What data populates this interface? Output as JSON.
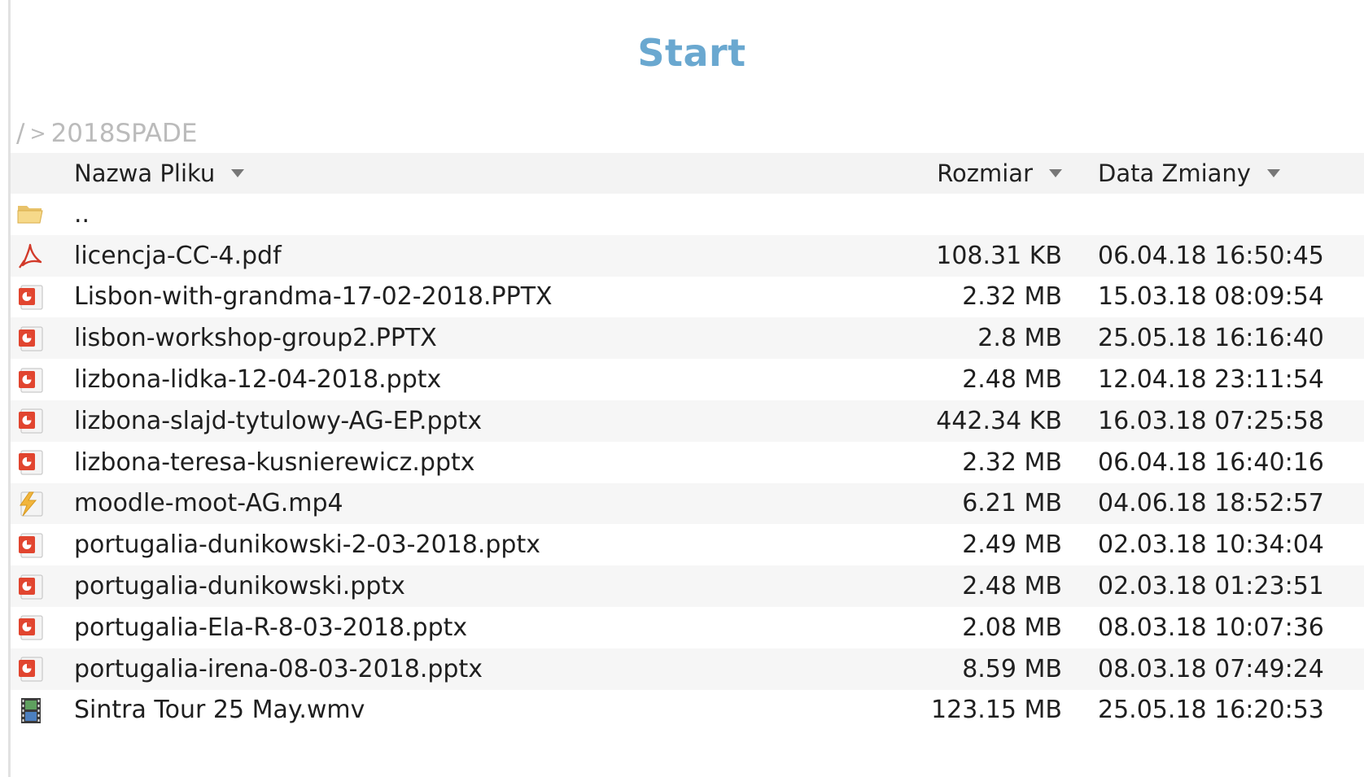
{
  "page": {
    "title": "Start"
  },
  "breadcrumb": {
    "root": "/",
    "separator": ">",
    "current": "2018SPADE"
  },
  "columns": {
    "name": "Nazwa Pliku",
    "size": "Rozmiar",
    "date": "Data Zmiany"
  },
  "colors": {
    "title": "#6aa8d0",
    "breadcrumb": "#bbbbbb",
    "stripe": "#f6f6f6"
  },
  "parent": {
    "label": "..",
    "icon": "folder-open-icon"
  },
  "files": [
    {
      "name": "licencja-CC-4.pdf",
      "size": "108.31 KB",
      "date": "06.04.18 16:50:45",
      "icon": "pdf-icon"
    },
    {
      "name": "Lisbon-with-grandma-17-02-2018.PPTX",
      "size": "2.32 MB",
      "date": "15.03.18 08:09:54",
      "icon": "powerpoint-icon"
    },
    {
      "name": "lisbon-workshop-group2.PPTX",
      "size": "2.8 MB",
      "date": "25.05.18 16:16:40",
      "icon": "powerpoint-icon"
    },
    {
      "name": "lizbona-lidka-12-04-2018.pptx",
      "size": "2.48 MB",
      "date": "12.04.18 23:11:54",
      "icon": "powerpoint-icon"
    },
    {
      "name": "lizbona-slajd-tytulowy-AG-EP.pptx",
      "size": "442.34 KB",
      "date": "16.03.18 07:25:58",
      "icon": "powerpoint-icon"
    },
    {
      "name": "lizbona-teresa-kusnierewicz.pptx",
      "size": "2.32 MB",
      "date": "06.04.18 16:40:16",
      "icon": "powerpoint-icon"
    },
    {
      "name": "moodle-moot-AG.mp4",
      "size": "6.21 MB",
      "date": "04.06.18 18:52:57",
      "icon": "flash-video-icon"
    },
    {
      "name": "portugalia-dunikowski-2-03-2018.pptx",
      "size": "2.49 MB",
      "date": "02.03.18 10:34:04",
      "icon": "powerpoint-icon"
    },
    {
      "name": "portugalia-dunikowski.pptx",
      "size": "2.48 MB",
      "date": "02.03.18 01:23:51",
      "icon": "powerpoint-icon"
    },
    {
      "name": "portugalia-Ela-R-8-03-2018.pptx",
      "size": "2.08 MB",
      "date": "08.03.18 10:07:36",
      "icon": "powerpoint-icon"
    },
    {
      "name": "portugalia-irena-08-03-2018.pptx",
      "size": "8.59 MB",
      "date": "08.03.18 07:49:24",
      "icon": "powerpoint-icon"
    },
    {
      "name": "Sintra Tour 25 May.wmv",
      "size": "123.15 MB",
      "date": "25.05.18 16:20:53",
      "icon": "film-icon"
    }
  ]
}
